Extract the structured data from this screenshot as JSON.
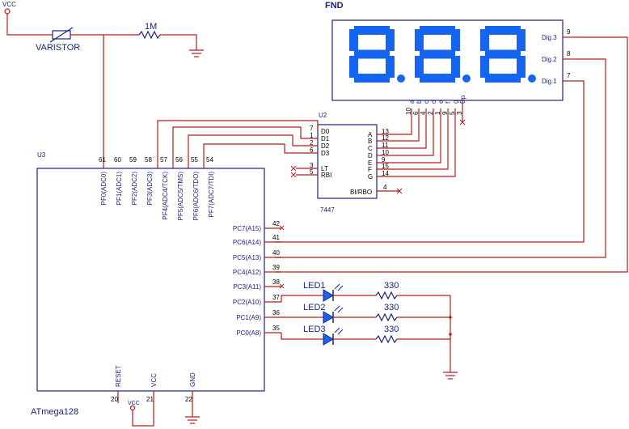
{
  "power": {
    "vcc_top": "VCC",
    "vcc_bottom": "VCC"
  },
  "varistor": {
    "label": "VARISTOR"
  },
  "resistor_top": {
    "value": "1M"
  },
  "fnd": {
    "title": "FND",
    "digit_glyph": "8",
    "digits": [
      "Dig.3",
      "Dig.2",
      "Dig.1"
    ],
    "digit_pins": [
      "9",
      "8",
      "7"
    ],
    "segment_names": [
      "a",
      "b",
      "c",
      "d",
      "e",
      "f",
      "g",
      "Dp"
    ],
    "segment_pins": [
      "10",
      "6",
      "4",
      "2",
      "1",
      "9",
      "5",
      "3"
    ]
  },
  "decoder": {
    "ref": "U2",
    "part": "7447",
    "inputs": [
      {
        "pin": "7",
        "name": "D0"
      },
      {
        "pin": "1",
        "name": "D1"
      },
      {
        "pin": "2",
        "name": "D2"
      },
      {
        "pin": "6",
        "name": "D3"
      }
    ],
    "control": [
      {
        "pin": "3",
        "name": "LT"
      },
      {
        "pin": "5",
        "name": "RBI"
      }
    ],
    "outputs": [
      {
        "pin": "13",
        "name": "A"
      },
      {
        "pin": "12",
        "name": "B"
      },
      {
        "pin": "11",
        "name": "C"
      },
      {
        "pin": "10",
        "name": "D"
      },
      {
        "pin": "9",
        "name": "E"
      },
      {
        "pin": "15",
        "name": "F"
      },
      {
        "pin": "14",
        "name": "G"
      }
    ],
    "bi": {
      "pin": "4",
      "name": "BI/RBO"
    }
  },
  "mcu": {
    "ref": "U3",
    "part": "ATmega128",
    "top_pins": [
      {
        "pin": "61",
        "name": "PF0(ADC0)"
      },
      {
        "pin": "60",
        "name": "PF1(ADC1)"
      },
      {
        "pin": "59",
        "name": "PF2(ADC2)"
      },
      {
        "pin": "58",
        "name": "PF3(ADC3)"
      },
      {
        "pin": "57",
        "name": "PF4(ADC4/TCK)"
      },
      {
        "pin": "56",
        "name": "PF5(ADC5/TMS)"
      },
      {
        "pin": "55",
        "name": "PF6(ADC6/TDO)"
      },
      {
        "pin": "54",
        "name": "PF7(ADC7/TDI)"
      }
    ],
    "right_pins": [
      {
        "pin": "42",
        "name": "PC7(A15)"
      },
      {
        "pin": "41",
        "name": "PC6(A14)"
      },
      {
        "pin": "40",
        "name": "PC5(A13)"
      },
      {
        "pin": "39",
        "name": "PC4(A12)"
      },
      {
        "pin": "38",
        "name": "PC3(A11)"
      },
      {
        "pin": "37",
        "name": "PC2(A10)"
      },
      {
        "pin": "36",
        "name": "PC1(A9)"
      },
      {
        "pin": "35",
        "name": "PC0(A8)"
      }
    ],
    "bottom_pins": [
      {
        "pin": "20",
        "name": "RESET"
      },
      {
        "pin": "21",
        "name": "VCC"
      },
      {
        "pin": "22",
        "name": "GND"
      }
    ]
  },
  "leds": [
    {
      "name": "LED1",
      "resistor": "330"
    },
    {
      "name": "LED2",
      "resistor": "330"
    },
    {
      "name": "LED3",
      "resistor": "330"
    }
  ],
  "colors": {
    "wire": "#b71c1c",
    "body": "#1a237e",
    "segment": "#1565f0"
  }
}
